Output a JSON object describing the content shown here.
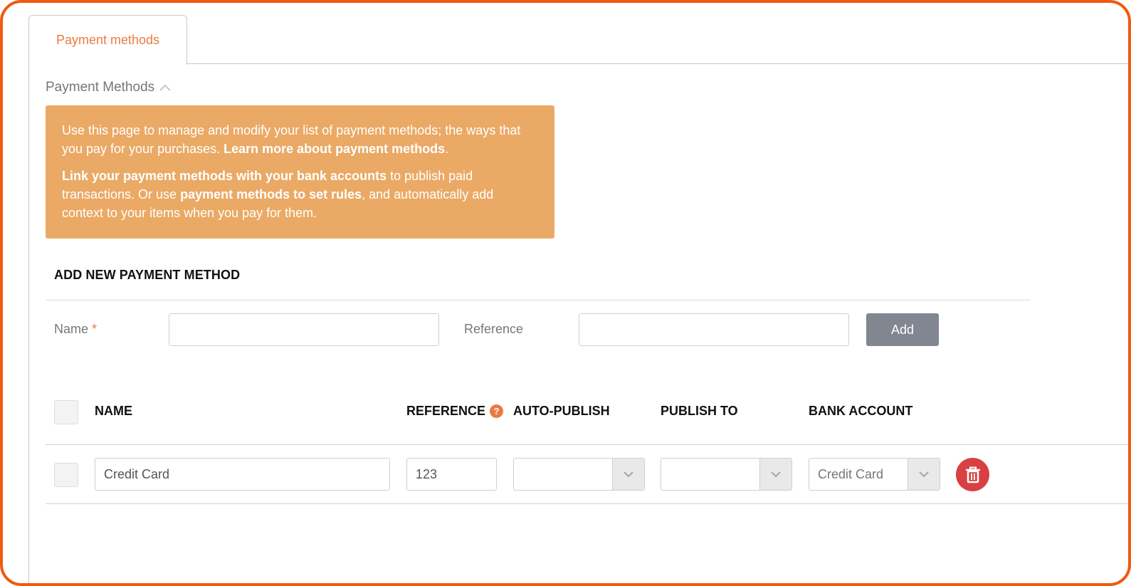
{
  "tabs": [
    {
      "label": "Payment methods"
    }
  ],
  "section": {
    "title": "Payment Methods",
    "toggle_icon": "chevron-up-icon"
  },
  "info": {
    "p1_text": "Use this page to manage and modify your list of payment methods; the ways that you pay for your purchases. ",
    "p1_link": "Learn more about payment methods",
    "p1_end": ".",
    "p2_bold1": "Link your payment methods with your bank accounts",
    "p2_text1": " to publish paid transactions. Or use ",
    "p2_bold2": "payment methods to set rules",
    "p2_text2": ", and automatically add context to your items when you pay for them."
  },
  "add_form": {
    "title": "ADD NEW PAYMENT METHOD",
    "name_label": "Name",
    "required_mark": "*",
    "name_value": "",
    "reference_label": "Reference",
    "reference_value": "",
    "add_button": "Add"
  },
  "table": {
    "headers": {
      "name": "NAME",
      "reference": "REFERENCE",
      "reference_help": "?",
      "auto_publish": "AUTO-PUBLISH",
      "publish_to": "PUBLISH TO",
      "bank_account": "BANK ACCOUNT"
    },
    "rows": [
      {
        "name": "Credit Card",
        "reference": "123",
        "auto_publish": "",
        "publish_to": "",
        "bank_account": "Credit Card"
      }
    ]
  },
  "colors": {
    "frame": "#f05a0e",
    "accent": "#ec7a40",
    "info_bg": "#eaa965",
    "button_gray": "#828690",
    "delete_red": "#d84042"
  }
}
